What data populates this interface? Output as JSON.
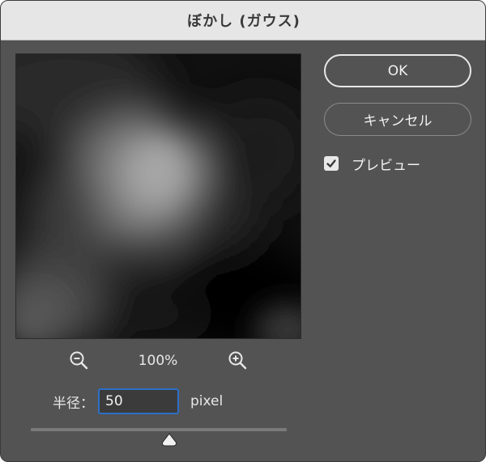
{
  "window": {
    "title": "ぼかし (ガウス)"
  },
  "preview": {
    "zoom_level": "100%",
    "zoom_out_icon": "zoom-out-icon",
    "zoom_in_icon": "zoom-in-icon"
  },
  "radius": {
    "label": "半径：",
    "value": "50",
    "unit": "pixel",
    "slider_fraction": 0.54
  },
  "buttons": {
    "ok_label": "OK",
    "cancel_label": "キャンセル"
  },
  "preview_toggle": {
    "label": "プレビュー",
    "checked": true
  },
  "colors": {
    "dialog_bg": "#535353",
    "titlebar_bg": "#e6e6e6",
    "focus_border": "#2d6fc7"
  }
}
